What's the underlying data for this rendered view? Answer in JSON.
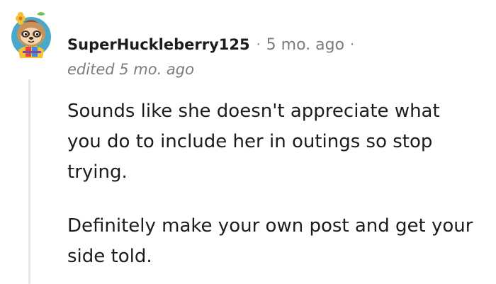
{
  "comment": {
    "username": "SuperHuckleberry125",
    "separator": "·",
    "timestamp": "5 mo. ago",
    "edited": "edited 5 mo. ago",
    "paragraphs": [
      "Sounds like she doesn't appreciate what you do to include her in outings so stop trying.",
      "Definitely make your own post and get your side told."
    ]
  },
  "colors": {
    "text": "#1c1c1c",
    "meta": "#7c7c7c",
    "thread_line": "#e8e8e8",
    "avatar_background": "#4aa9c9",
    "avatar_face": "#c9925b",
    "flower": "#f2c230"
  },
  "icons": {
    "avatar": "snoo-avatar-sloth-with-flower"
  }
}
